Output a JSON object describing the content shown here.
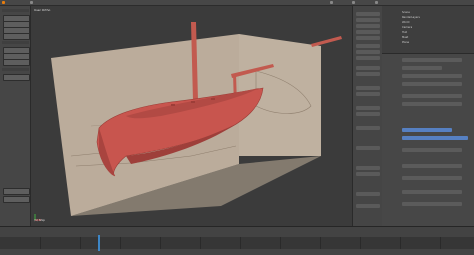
{
  "window": {
    "title": "",
    "top_menu": [
      "",
      "",
      "",
      ""
    ]
  },
  "toolshelf": {
    "items": 9
  },
  "viewport": {
    "label": "User Ortho",
    "object_name": "(1) Ship"
  },
  "outliner": {
    "rows": [
      "Scene",
      "RenderLayers",
      "World",
      "Camera",
      "Hull",
      "Mast",
      "Plane"
    ]
  },
  "colors": {
    "hull": "#c8554e",
    "panel_bg": "#474747",
    "viewport_bg": "#3b3b3b",
    "accent": "#5680c2"
  }
}
